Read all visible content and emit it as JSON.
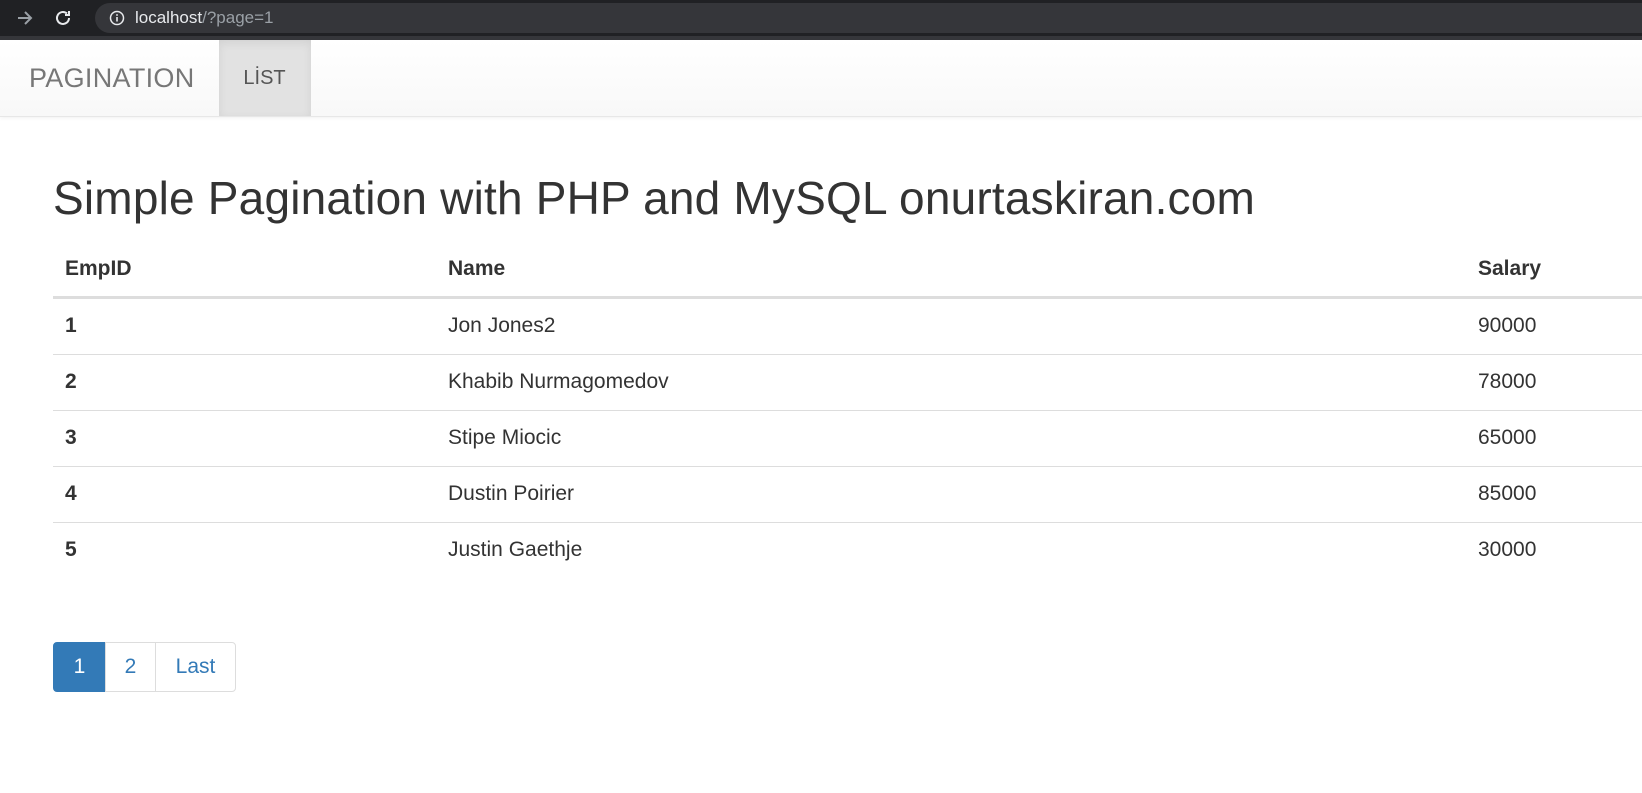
{
  "browser": {
    "url_host": "localhost",
    "url_path": "/?page=1"
  },
  "navbar": {
    "brand": "PAGINATION",
    "items": [
      {
        "label": "LİST",
        "active": true
      }
    ]
  },
  "main": {
    "heading": "Simple Pagination with PHP and MySQL onurtaskiran.com",
    "table": {
      "columns": [
        "EmpID",
        "Name",
        "Salary"
      ],
      "rows": [
        {
          "id": "1",
          "name": "Jon Jones2",
          "salary": "90000"
        },
        {
          "id": "2",
          "name": "Khabib Nurmagomedov",
          "salary": "78000"
        },
        {
          "id": "3",
          "name": "Stipe Miocic",
          "salary": "65000"
        },
        {
          "id": "4",
          "name": "Dustin Poirier",
          "salary": "85000"
        },
        {
          "id": "5",
          "name": "Justin Gaethje",
          "salary": "30000"
        }
      ]
    },
    "pagination": {
      "pages": [
        "1",
        "2"
      ],
      "current": "1",
      "last_label": "Last"
    }
  },
  "colors": {
    "accent": "#337ab7",
    "chrome_bg": "#202124",
    "text": "#333333"
  },
  "icons": [
    "forward-arrow-icon",
    "reload-icon",
    "info-icon"
  ]
}
